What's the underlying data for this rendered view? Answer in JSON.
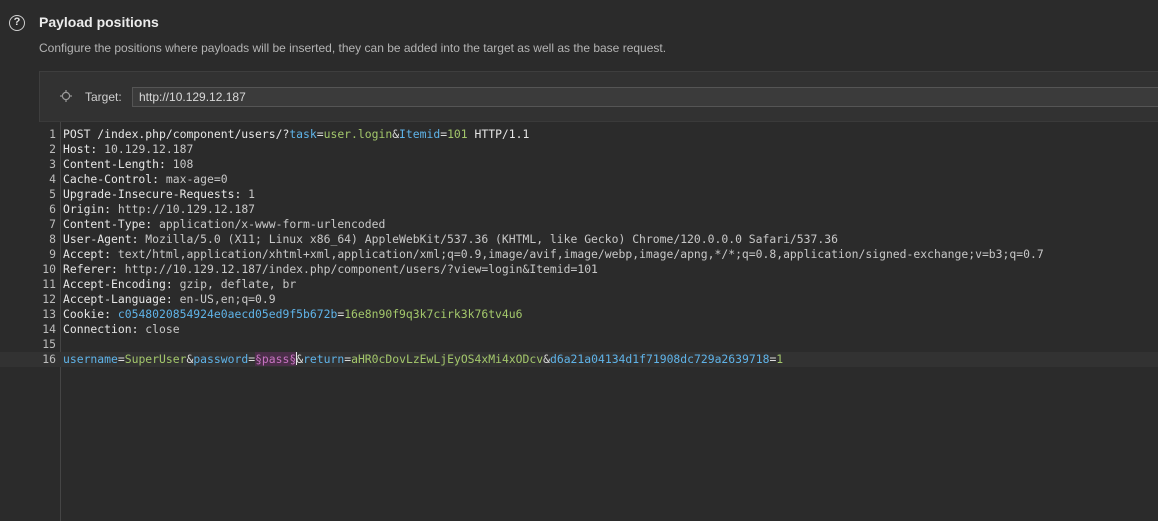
{
  "section": {
    "help_icon": "question-mark-icon",
    "help_glyph": "?",
    "title": "Payload positions",
    "description": "Configure the positions where payloads will be inserted, they can be added into the target as well as the base request."
  },
  "target": {
    "icon": "crosshair-icon",
    "label": "Target:",
    "value": "http://10.129.12.187"
  },
  "colors": {
    "background": "#2b2b2b",
    "panel": "#323232",
    "param_name": "#5fb3e8",
    "param_value": "#a3c76b",
    "payload_marker": "#c773c1"
  },
  "request": {
    "lines": [
      {
        "num": "1",
        "segments": [
          {
            "t": "POST /index.php/component/users/?",
            "c": "hdr-name"
          },
          {
            "t": "task",
            "c": "param-name"
          },
          {
            "t": "=",
            "c": "op"
          },
          {
            "t": "user.login",
            "c": "param-val"
          },
          {
            "t": "&",
            "c": "op"
          },
          {
            "t": "Itemid",
            "c": "param-name"
          },
          {
            "t": "=",
            "c": "op"
          },
          {
            "t": "101",
            "c": "param-val"
          },
          {
            "t": " HTTP/1.1",
            "c": "hdr-name"
          }
        ]
      },
      {
        "num": "2",
        "segments": [
          {
            "t": "Host: ",
            "c": "hdr-name"
          },
          {
            "t": "10.129.12.187",
            "c": "hdr-val"
          }
        ]
      },
      {
        "num": "3",
        "segments": [
          {
            "t": "Content-Length: ",
            "c": "hdr-name"
          },
          {
            "t": "108",
            "c": "hdr-val"
          }
        ]
      },
      {
        "num": "4",
        "segments": [
          {
            "t": "Cache-Control: ",
            "c": "hdr-name"
          },
          {
            "t": "max-age=0",
            "c": "hdr-val"
          }
        ]
      },
      {
        "num": "5",
        "segments": [
          {
            "t": "Upgrade-Insecure-Requests: ",
            "c": "hdr-name"
          },
          {
            "t": "1",
            "c": "hdr-val"
          }
        ]
      },
      {
        "num": "6",
        "segments": [
          {
            "t": "Origin: ",
            "c": "hdr-name"
          },
          {
            "t": "http://10.129.12.187",
            "c": "hdr-val"
          }
        ]
      },
      {
        "num": "7",
        "segments": [
          {
            "t": "Content-Type: ",
            "c": "hdr-name"
          },
          {
            "t": "application/x-www-form-urlencoded",
            "c": "hdr-val"
          }
        ]
      },
      {
        "num": "8",
        "segments": [
          {
            "t": "User-Agent: ",
            "c": "hdr-name"
          },
          {
            "t": "Mozilla/5.0 (X11; Linux x86_64) AppleWebKit/537.36 (KHTML, like Gecko) Chrome/120.0.0.0 Safari/537.36",
            "c": "hdr-val"
          }
        ]
      },
      {
        "num": "9",
        "segments": [
          {
            "t": "Accept: ",
            "c": "hdr-name"
          },
          {
            "t": "text/html,application/xhtml+xml,application/xml;q=0.9,image/avif,image/webp,image/apng,*/*;q=0.8,application/signed-exchange;v=b3;q=0.7",
            "c": "hdr-val"
          }
        ]
      },
      {
        "num": "10",
        "segments": [
          {
            "t": "Referer: ",
            "c": "hdr-name"
          },
          {
            "t": "http://10.129.12.187/index.php/component/users/?view=login&Itemid=101",
            "c": "hdr-val"
          }
        ]
      },
      {
        "num": "11",
        "segments": [
          {
            "t": "Accept-Encoding: ",
            "c": "hdr-name"
          },
          {
            "t": "gzip, deflate, br",
            "c": "hdr-val"
          }
        ]
      },
      {
        "num": "12",
        "segments": [
          {
            "t": "Accept-Language: ",
            "c": "hdr-name"
          },
          {
            "t": "en-US,en;q=0.9",
            "c": "hdr-val"
          }
        ]
      },
      {
        "num": "13",
        "segments": [
          {
            "t": "Cookie: ",
            "c": "hdr-name"
          },
          {
            "t": "c0548020854924e0aecd05ed9f5b672b",
            "c": "param-name"
          },
          {
            "t": "=",
            "c": "op"
          },
          {
            "t": "16e8n90f9q3k7cirk3k76tv4u6",
            "c": "param-val"
          }
        ]
      },
      {
        "num": "14",
        "segments": [
          {
            "t": "Connection: ",
            "c": "hdr-name"
          },
          {
            "t": "close",
            "c": "hdr-val"
          }
        ]
      },
      {
        "num": "15",
        "segments": []
      },
      {
        "num": "16",
        "current": true,
        "segments": [
          {
            "t": "username",
            "c": "param-name"
          },
          {
            "t": "=",
            "c": "op"
          },
          {
            "t": "SuperUser",
            "c": "param-val"
          },
          {
            "t": "&",
            "c": "op"
          },
          {
            "t": "password",
            "c": "param-name"
          },
          {
            "t": "=",
            "c": "op"
          },
          {
            "t": "§pass§",
            "c": "payload-marker"
          },
          {
            "t": "",
            "c": "caret"
          },
          {
            "t": "&",
            "c": "op"
          },
          {
            "t": "return",
            "c": "param-name"
          },
          {
            "t": "=",
            "c": "op"
          },
          {
            "t": "aHR0cDovLzEwLjEyOS4xMi4xODcv",
            "c": "param-val"
          },
          {
            "t": "&",
            "c": "op"
          },
          {
            "t": "d6a21a04134d1f71908dc729a2639718",
            "c": "param-name"
          },
          {
            "t": "=",
            "c": "op"
          },
          {
            "t": "1",
            "c": "param-val"
          }
        ]
      }
    ]
  }
}
